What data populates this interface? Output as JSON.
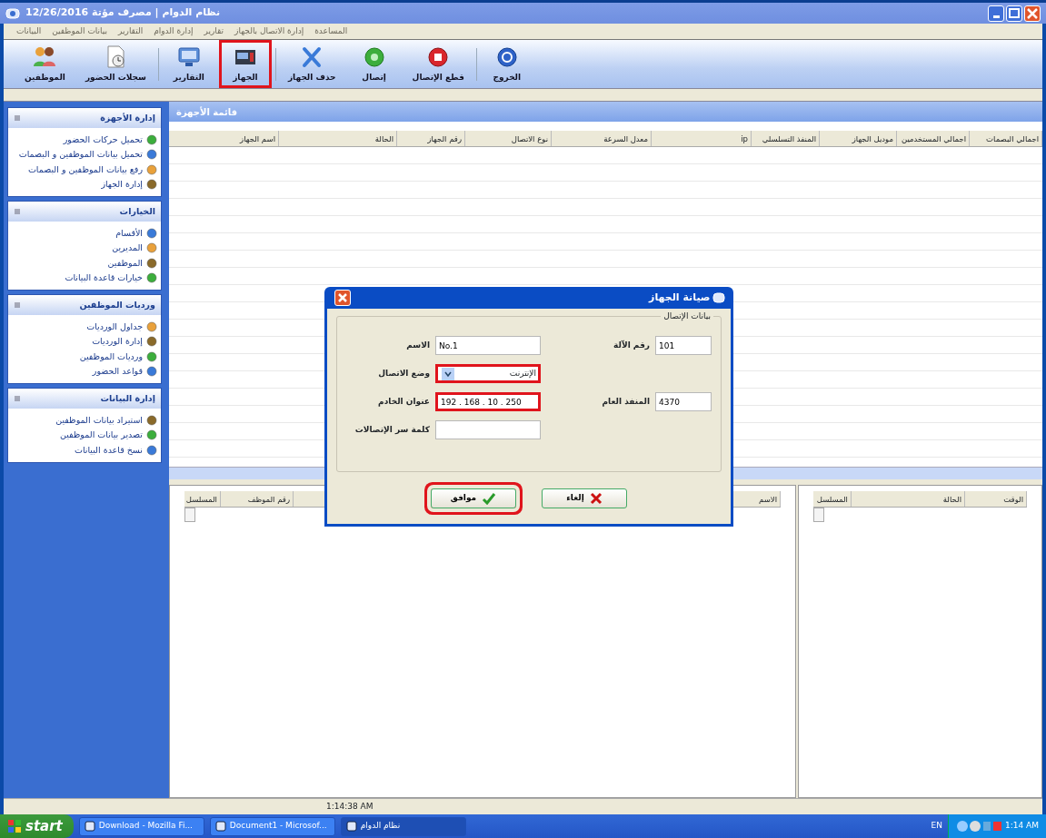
{
  "window": {
    "title": "نظام الدوام | مصرف مؤتة 12/26/2016"
  },
  "menu": [
    "المساعدة",
    "إدارة الاتصال بالجهاز",
    "تقارير",
    "إدارة الدوام",
    "التقارير",
    "بيانات الموظفين",
    "البيانات"
  ],
  "toolbar": [
    {
      "label": "الخروج",
      "highlighted": false
    },
    {
      "label": "قطع الإتصال",
      "highlighted": false
    },
    {
      "label": "إتصال",
      "highlighted": false
    },
    {
      "label": "حذف الجهاز",
      "highlighted": false
    },
    {
      "label": "الجهاز",
      "highlighted": true
    },
    {
      "label": "التقارير",
      "highlighted": false
    },
    {
      "label": "سجلات الحضور",
      "highlighted": false
    },
    {
      "label": "الموظفين",
      "highlighted": false
    }
  ],
  "sidebar": [
    {
      "title": "إدارة الأجهزة",
      "items": [
        "تحميل حركات الحضور",
        "تحميل بيانات الموظفين و البصمات",
        "رفع بيانات الموظفين و البصمات",
        "إدارة الجهاز"
      ]
    },
    {
      "title": "الخيارات",
      "items": [
        "الأقسام",
        "المديرين",
        "الموظفين",
        "خيارات قاعدة البيانات"
      ]
    },
    {
      "title": "ورديات الموظفين",
      "items": [
        "جداول الورديات",
        "إدارة الورديات",
        "ورديات الموظفين",
        "قواعد الحضور"
      ]
    },
    {
      "title": "إدارة البيانات",
      "items": [
        "استيراد بيانات الموظفين",
        "تصدير بيانات الموظفين",
        "نسخ قاعدة البيانات"
      ]
    }
  ],
  "device_list": {
    "title": "قائمة الأجهزة",
    "columns": [
      "اجمالي البصمات",
      "اجمالي المستخدمين",
      "موديل الجهاز",
      "المنفذ التسلسلي",
      "ip",
      "معدل السرعة",
      "نوع الاتصال",
      "رقم الجهاز",
      "الحالة",
      "اسم الجهاز"
    ]
  },
  "employees_grid": {
    "columns": [
      "الاسم",
      "رقم الموظف",
      "المسلسل"
    ]
  },
  "log_grid": {
    "columns": [
      "الوقت",
      "الحالة",
      "المسلسل"
    ]
  },
  "dialog": {
    "title": "صيانة الجهاز",
    "group_title": "بيانات الإتصال",
    "rows": [
      [
        {
          "kind": "text",
          "label": "رقم الآلة",
          "value": "101",
          "highlighted": false
        },
        {
          "kind": "text",
          "label": "الاسم",
          "value": "No.1",
          "highlighted": false
        }
      ],
      [
        {
          "kind": "select",
          "label": "وضع الاتصال",
          "value": "الإنترنت",
          "highlighted": true
        }
      ],
      [
        {
          "kind": "text",
          "label": "المنفذ العام",
          "value": "4370",
          "highlighted": false
        },
        {
          "kind": "text",
          "label": "عنوان الخادم",
          "value": "192 . 168 . 10 . 250",
          "highlighted": true
        }
      ],
      [
        {
          "kind": "text",
          "label": "كلمة سر الإتصالات",
          "highlighted": false
        }
      ]
    ],
    "buttons": [
      {
        "kind": "cancel",
        "label": "إلغاء",
        "highlighted": false
      },
      {
        "kind": "ok",
        "label": "موافق",
        "highlighted": true
      }
    ]
  },
  "status_bar": {
    "time": "1:14:38 AM"
  },
  "taskbar": {
    "start": "start",
    "tasks": [
      {
        "label": "نظام الدوام",
        "selected": true
      },
      {
        "label": "Document1 - Microsof...",
        "selected": false
      },
      {
        "label": "Download - Mozilla Fi...",
        "selected": false
      }
    ],
    "language": "EN",
    "clock": "1:14 AM"
  }
}
